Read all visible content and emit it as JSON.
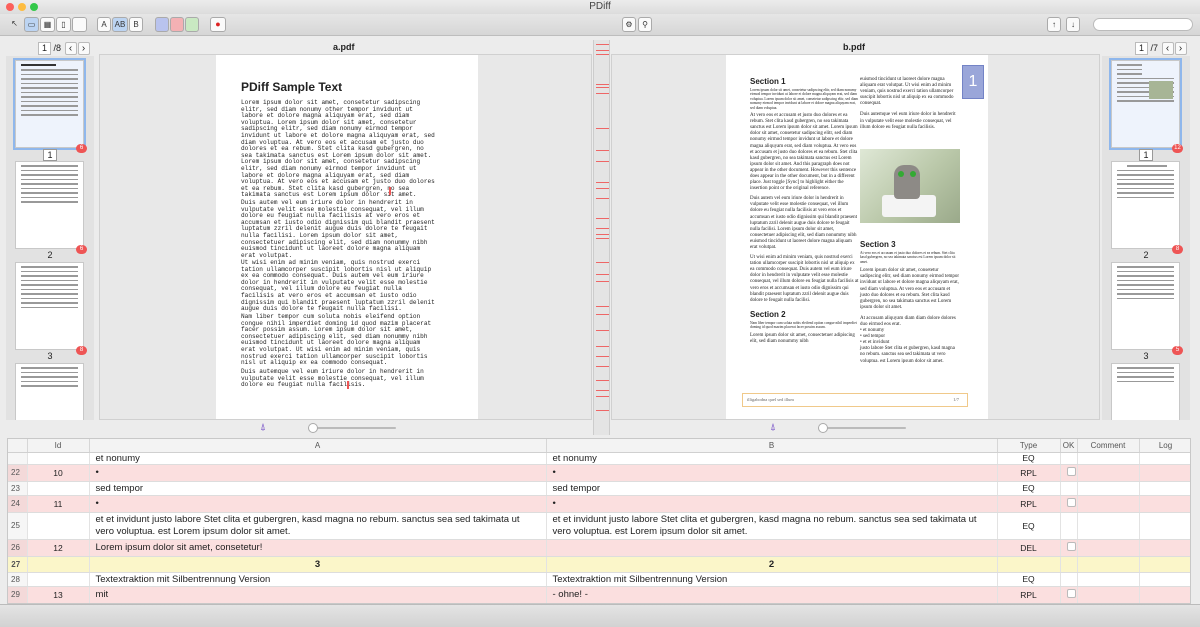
{
  "app": {
    "title": "PDiff"
  },
  "toolbar": {
    "text_btn_a": "A",
    "text_btn_ab": "AB",
    "text_btn_b": "B"
  },
  "left": {
    "file": "a.pdf",
    "page": "1",
    "total": "/8",
    "thumb_labels": [
      "1",
      "2",
      "3"
    ],
    "badge_values": [
      "6",
      "6",
      "8"
    ],
    "doc": {
      "title": "PDiff Sample Text",
      "paragraphs": [
        "Lorem ipsum dolor sit amet, consetetur sadipscing\nelitr, sed diam nonumy other tempor invidunt ut\nlabore et dolore magna aliquyam erat, sed diam\nvoluptua. Lorem ipsum dolor sit amet, consetetur\nsadipscing elitr, sed diam nonumy eirmod tempor\ninvidunt ut labore et dolore magna aliquyam erat, sed\ndiam voluptua. At vero eos et accusam et justo duo\ndolores et ea rebum. Stet clita kasd gubergren, no\nsea takimata sanctus est Lorem ipsum dolor sit amet.\nLorem ipsum dolor sit amet, consetetur sadipscing\nelitr, sed diam nonumy eirmod tempor invidunt ut\nlabore et dolore magna aliquyam erat, sed diam\nvoluptua. At vero eos et accusam et justo duo dolores\net ea rebum. Stet clita kasd gubergren, no sea\ntakimata sanctus est Lorem ipsum dolor sit amet.",
        "Duis autem vel eum iriure dolor in hendrerit in\nvulputate velit esse molestie consequat, vel illum\ndolore eu feugiat nulla facilisis at vero eros et\naccumsan et iusto odio dignissim qui blandit praesent\nluptatum zzril delenit augue duis dolore te feugait\nnulla facilisi. Lorem ipsum dolor sit amet,\nconsectetuer adipiscing elit, sed diam nonummy nibh\neuismod tincidunt ut laoreet dolore magna aliquam\nerat volutpat.",
        "Ut wisi enim ad minim veniam, quis nostrud exerci\ntation ullamcorper suscipit lobortis nisl ut aliquip\nex ea commodo consequat. Duis autem vel eum iriure\ndolor in hendrerit in vulputate velit esse molestie\nconsequat, vel illum dolore eu feugiat nulla\nfacilisis at vero eros et accumsan et iusto odio\ndignissim qui blandit praesent luptatum zzril delenit\naugue duis dolore te feugait nulla facilisi.",
        "Nam liber tempor cum soluta nobis eleifend option\ncongue nihil imperdiet doming id quod mazim placerat\nfacer possim assum. Lorem ipsum dolor sit amet,\nconsectetuer adipiscing elit, sed diam nonummy nibh\neuismod tincidunt ut laoreet dolore magna aliquam\nerat volutpat. Ut wisi enim ad minim veniam, quis\nnostrud exerci tation ullamcorper suscipit lobortis\nnisl ut aliquip ex ea commodo consequat.",
        "Duis autemque vel eum iriure dolor in hendrerit in\nvulputate velit esse molestie consequat, vel illum\ndolore eu feugiat nulla facilisis."
      ]
    }
  },
  "right": {
    "file": "b.pdf",
    "page": "1",
    "total": "/7",
    "thumb_labels": [
      "1",
      "2",
      "3"
    ],
    "badge_values": [
      "12",
      "8",
      "5"
    ],
    "doc": {
      "section1": "Section 1",
      "section1_small": "Lorem ipsum dolor sit amet, consetetur sadipscing elitr, sed diam nonumy eirmod tempor invidunt ut labore et dolore magna aliquyam erat, sed diam voluptua. Lorem ipsum dolor sit amet, consetetur sadipscing elitr, sed diam nonumy eirmod tempor invidunt ut labore et dolore magna aliquyam erat, sed diam voluptua.",
      "section1_body": "At vero eos et accusam et justo duo dolores et ea rebum. Stet clita kasd gubergren, no sea takimata sanctus est Lorem ipsum dolor sit amet. Lorem ipsum dolor sit amet, consetetur sadipscing elitr, sed diam nonumy eirmod tempor invidunt ut labore et dolore magna aliquyam erat, sed diam voluptua. At vero eos et accusam et justo duo dolores et ea rebum. Stet clita kasd gubergren, no sea takimata sanctus est Lorem ipsum dolor sit amet. And this paragraph does not appear in the other document. However this sentence does appear in the other document, but in a different place. Just toggle [Sync] to highlight either the insertion point or the original reference.",
      "section1_body2": "Duis autem vel eum iriure dolor in hendrerit in vulputate velit esse molestie consequat, vel illum dolore eu feugiat nulla facilisis at vero eros et accumsan et iusto odio dignissim qui blandit praesent luptatum zzril delenit augue duis dolore te feugait nulla facilisi. Lorem ipsum dolor sit amet, consectetuer adipiscing elit, sed diam nonummy nibh euismod tincidunt ut laoreet dolore magna aliquam erat volutpat.",
      "section1_body3": "Ut wisi enim ad minim veniam, quis nostrud exerci tation ullamcorper suscipit lobortis nisl ut aliquip ex ea commodo consequat. Duis autem vel eum iriure dolor in hendrerit in vulputate velit esse molestie consequat, vel illum dolore eu feugiat nulla facilisis at vero eros et accumsan et iusto odio dignissim qui blandit praesent luptatum zzril delenit augue duis dolore te feugait nulla facilisi.",
      "section2": "Section 2",
      "section2_small": "Nam liber tempor cum soluta nobis eleifend option congue nihil imperdiet doming id quod mazim placerat facer possim assum.",
      "section2_body": "Lorem ipsum dolor sit amet, consectetuer adipiscing elit, sed diam nonummy nibh",
      "col2_top": "euismod tincidunt ut laoreet dolore magna aliquam erat volutpat. Ut wisi enim ad minim veniam, quis nostrud exerci tation ullamcorper suscipit lobortis nisl ut aliquip ex ea commodo consequat.",
      "col2_top2": "Duis autemque vel eum iriure dolor in hendrerit in vulputate velit esse molestie consequat, vel illum dolore eu feugiat nulla facilisis.",
      "page_number_box": "1",
      "section3": "Section 3",
      "section3_small": "At vero eos et accusam et justo duo dolores et ea rebum. Stet clita kasd gubergren, no sea takimata sanctus est Lorem ipsum dolor sit amet.",
      "section3_body": "Lorem ipsum dolor sit amet, consetetur sadipscing elitr, sed diam nonumy eirmod tempor invidunt ut labore et dolore magna aliquyam erat, sed diam voluptua. At vero eos et accusam et justo duo dolores et ea rebum. Stet clita kasd gubergren, no sea takimata sanctus est Lorem ipsum dolor sit amet.",
      "section3_list_intro": "At accusam aliquyam diam diam dolore dolores duo eirmod eos erat.",
      "section3_list": [
        "• et nonumy",
        "• sed tempor",
        "• et et invidunt"
      ],
      "section3_end": "justo labore Stet clita et gubergren, kasd magna no rebum. sanctus sea sed takimata ut vero voluptua. est Lorem ipsum dolor sit amet.",
      "footer_left": "illigabodna quel sed illum",
      "footer_right": "1/7"
    }
  },
  "grid": {
    "columns": [
      "",
      "Id",
      "A",
      "B",
      "Type",
      "OK",
      "Comment",
      "Log"
    ],
    "rows": [
      {
        "n": "",
        "id": "",
        "a": "et nonumy",
        "b": "et nonumy",
        "type": "EQ",
        "cls": "",
        "ok": false
      },
      {
        "n": "22",
        "id": "10",
        "a": "•",
        "b": "•",
        "type": "RPL",
        "cls": "rpl",
        "ok": true
      },
      {
        "n": "23",
        "id": "",
        "a": "sed tempor",
        "b": "sed tempor",
        "type": "EQ",
        "cls": "",
        "ok": false
      },
      {
        "n": "24",
        "id": "11",
        "a": "•",
        "b": "•",
        "type": "RPL",
        "cls": "rpl",
        "ok": true
      },
      {
        "n": "25",
        "id": "",
        "a": "et et invidunt justo labore Stet clita et gubergren, kasd magna no rebum. sanctus sea sed takimata ut vero voluptua. est Lorem ipsum dolor sit amet.",
        "b": "et et invidunt justo labore Stet clita et gubergren, kasd magna no rebum. sanctus sea sed takimata ut vero voluptua. est Lorem ipsum dolor sit amet.",
        "type": "EQ",
        "cls": "tall",
        "ok": false
      },
      {
        "n": "26",
        "id": "12",
        "a": "Lorem ipsum dolor sit amet, consetetur!",
        "b": "",
        "type": "DEL",
        "cls": "del",
        "ok": true
      },
      {
        "n": "27",
        "id": "",
        "a": "3",
        "b": "2",
        "type": "",
        "cls": "hdr",
        "ok": false
      },
      {
        "n": "28",
        "id": "",
        "a": "Textextraktion mit Silbentrennung Version",
        "b": "Textextraktion mit Silbentrennung Version",
        "type": "EQ",
        "cls": "",
        "ok": false
      },
      {
        "n": "29",
        "id": "13",
        "a": "mit",
        "b": "- ohne! -",
        "type": "RPL",
        "cls": "rpl",
        "ok": true
      }
    ]
  },
  "colors": {
    "accent": "#8fb7ec",
    "diff_red": "#e55555",
    "rpl_row": "#fbdfdf",
    "header_row": "#fbf6c9"
  }
}
